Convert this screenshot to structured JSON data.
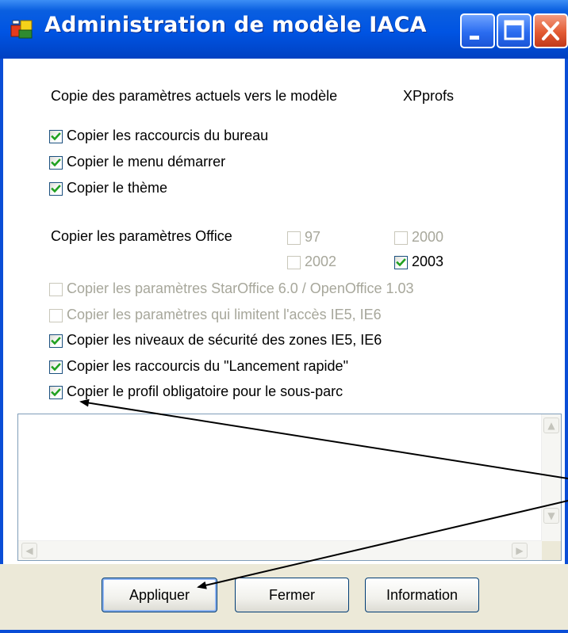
{
  "window": {
    "title": "Administration de modèle IACA",
    "controls": [
      "minimize",
      "maximize",
      "close"
    ]
  },
  "header": {
    "label": "Copie des paramètres actuels vers le modèle",
    "model_name": "XPprofs"
  },
  "options_top": [
    {
      "label": "Copier les raccourcis du bureau",
      "checked": true,
      "enabled": true
    },
    {
      "label": "Copier le menu démarrer",
      "checked": true,
      "enabled": true
    },
    {
      "label": "Copier le thème",
      "checked": true,
      "enabled": true
    }
  ],
  "office": {
    "label": "Copier les paramètres Office",
    "versions": [
      {
        "label": "97",
        "checked": false,
        "enabled": false
      },
      {
        "label": "2000",
        "checked": false,
        "enabled": false
      },
      {
        "label": "2002",
        "checked": false,
        "enabled": false
      },
      {
        "label": "2003",
        "checked": true,
        "enabled": true
      }
    ]
  },
  "options_bottom": [
    {
      "label": "Copier les paramètres StarOffice 6.0 / OpenOffice 1.03",
      "checked": false,
      "enabled": false
    },
    {
      "label": "Copier les paramètres qui limitent l'accès IE5, IE6",
      "checked": false,
      "enabled": false
    },
    {
      "label": "Copier les niveaux de sécurité des zones IE5, IE6",
      "checked": true,
      "enabled": true
    },
    {
      "label": "Copier les raccourcis du \"Lancement rapide\"",
      "checked": true,
      "enabled": true
    },
    {
      "label": "Copier le profil obligatoire pour le sous-parc",
      "checked": true,
      "enabled": true
    }
  ],
  "buttons": {
    "apply": "Appliquer",
    "close": "Fermer",
    "info": "Information"
  },
  "colors": {
    "titlebar": "#0054e3",
    "check": "#21a121",
    "panel": "#ece9d8"
  }
}
